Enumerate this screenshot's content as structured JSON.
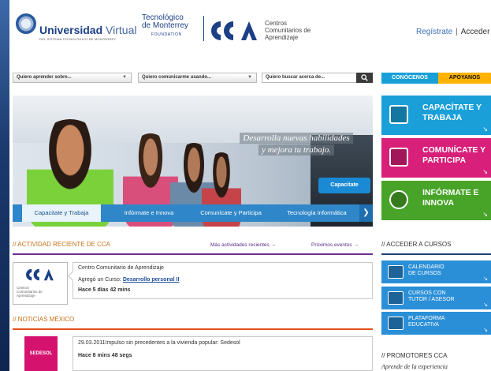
{
  "header": {
    "uv_name_bold": "Universidad",
    "uv_name_thin": "Virtual",
    "uv_sub": "DEL SISTEMA TECNOLÓGICO DE MONTERREY",
    "tec_line1": "Tecnológico",
    "tec_line2": "de Monterrey",
    "tec_foundation": "FOUNDATION",
    "cca_line1": "Centros",
    "cca_line2": "Comunitarios de",
    "cca_line3": "Aprendizaje",
    "register_label": "Regístrate",
    "access_label": "Acceder"
  },
  "search": {
    "learn_label": "Quiero aprender sobre...",
    "communicate_label": "Quiero comunicarme usando...",
    "search_placeholder": "Quiero buscar acerca de...",
    "search_button_icon": "search-icon"
  },
  "top_tabs": {
    "know_label": "CONÓCENOS",
    "support_label": "APÓYANOS"
  },
  "hero": {
    "caption_line1": "Desarrolla nuevas habilidades",
    "caption_line2": "y mejora tu trabajo.",
    "cta_label": "Capacitate",
    "tabs": [
      {
        "label": "Capacitate y Trabaja"
      },
      {
        "label": "Infórmate e Innova"
      },
      {
        "label": "Comunícate y Participa"
      },
      {
        "label": "Tecnología Informática"
      }
    ],
    "next_icon": "chevron-right-icon"
  },
  "tiles": [
    {
      "line1": "CAPACÍTATE Y",
      "line2": "TRABAJA",
      "icon": "monitor-icon",
      "color": "#1a9fd9"
    },
    {
      "line1": "COMUNÍCATE Y",
      "line2": "PARTICIPA",
      "icon": "chat-icon",
      "color": "#d81f79"
    },
    {
      "line1": "INFÓRMATE E",
      "line2": "INNOVA",
      "icon": "lightbulb-icon",
      "color": "#47a428"
    }
  ],
  "activity": {
    "heading": "// ACTIVIDAD RECIENTE DE CCA",
    "more_link": "Más actividades recientes →",
    "events_link": "Próximos eventos →",
    "logo_text_1": "Centros",
    "logo_text_2": "Comunitarios de",
    "logo_text_3": "Aprendizaje",
    "org": "Centro Comunitario de Aprendizaje",
    "action": "Agregó un Curso: ",
    "course": "Desarrollo personal II",
    "time": "Hace 5 días 42 mins"
  },
  "news": {
    "heading": "// NOTICIAS MÉXICO",
    "source": "SEDESOL",
    "headline": "29.03.2011Impulso sin precedentes a la vivienda popular: Sedesol",
    "time": "Hace 8 mins 48 segs"
  },
  "courses": {
    "heading": "// ACCEDER A CURSOS",
    "items": [
      {
        "line1": "CALENDARIO",
        "line2": "DE CURSOS",
        "icon": "calendar-icon"
      },
      {
        "line1": "CURSOS CON",
        "line2": "TUTOR / ASESOR",
        "icon": "people-icon"
      },
      {
        "line1": "PLATAFORMA",
        "line2": "EDUCATIVA",
        "icon": "screen-icon"
      }
    ]
  },
  "promoters": {
    "heading": "// PROMOTORES CCA",
    "subtitle": "Aprende de la experiencia"
  },
  "colors": {
    "brand_blue": "#1c3f86",
    "activity_purple": "#6e2d8f",
    "news_orange": "#e2511c",
    "sedesol_pink": "#d5136f"
  }
}
